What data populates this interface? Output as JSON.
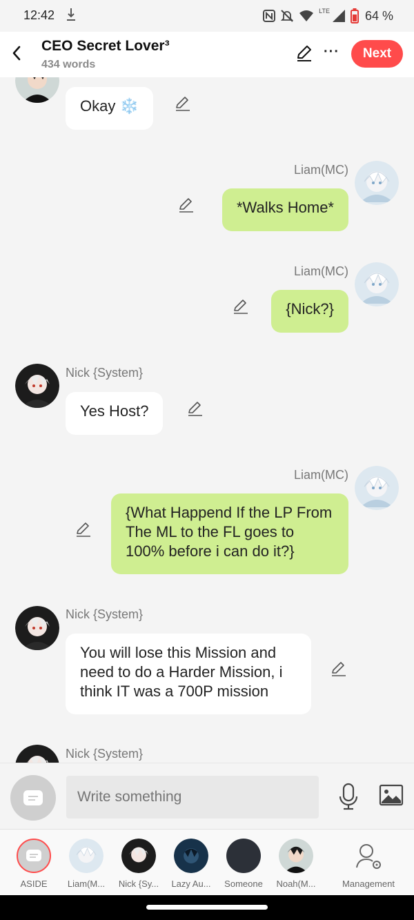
{
  "status": {
    "time": "12:42",
    "lte": "LTE",
    "battery": "64 %"
  },
  "header": {
    "title": "CEO Secret Lover³",
    "words": "434 words",
    "next_label": "Next"
  },
  "messages": [
    {
      "side": "left",
      "speaker": "",
      "text": "Okay ❄️"
    },
    {
      "side": "right",
      "speaker": "Liam(MC)",
      "text": "*Walks Home*"
    },
    {
      "side": "right",
      "speaker": "Liam(MC)",
      "text": "{Nick?}"
    },
    {
      "side": "left",
      "speaker": "Nick {System}",
      "text": "Yes Host?"
    },
    {
      "side": "right",
      "speaker": "Liam(MC)",
      "text": "{What Happend If the LP From The ML to the FL goes to 100% before i can do it?}"
    },
    {
      "side": "left",
      "speaker": "Nick {System}",
      "text": "You will lose this Mission and need to do a Harder Mission, i think IT was a 700P mission"
    },
    {
      "side": "left",
      "speaker": "Nick {System}",
      "text": ""
    }
  ],
  "input": {
    "placeholder": "Write something"
  },
  "characters": [
    {
      "label": "ASIDE"
    },
    {
      "label": "Liam(M..."
    },
    {
      "label": "Nick {Sy..."
    },
    {
      "label": "Lazy Au..."
    },
    {
      "label": "Someone"
    },
    {
      "label": "Noah(M..."
    },
    {
      "label": "Management"
    }
  ],
  "colors": {
    "accent": "#ff4b4b",
    "right_bubble": "#cfee91",
    "left_bubble": "#ffffff",
    "background": "#f4f4f4"
  }
}
